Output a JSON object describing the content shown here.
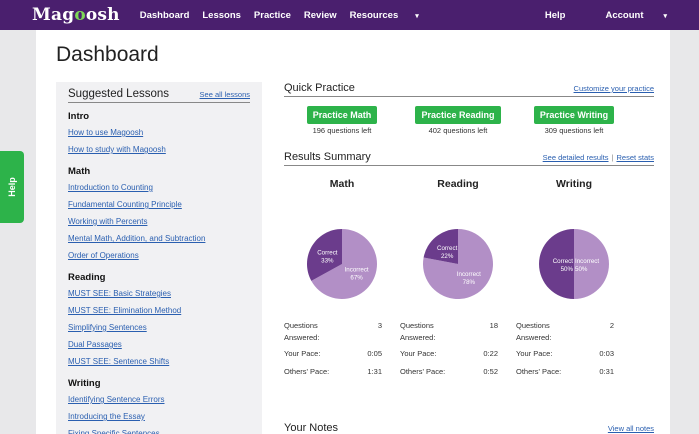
{
  "nav": {
    "logo_main": "Mag",
    "logo_o": "o",
    "logo_tail": "osh",
    "items": [
      "Dashboard",
      "Lessons",
      "Practice",
      "Review",
      "Resources"
    ],
    "resources_caret": "▾",
    "help": "Help",
    "account": "Account",
    "account_caret": "▾"
  },
  "help_tab": "Help",
  "page_title": "Dashboard",
  "suggested": {
    "title": "Suggested Lessons",
    "see_all": "See all lessons",
    "sections": [
      {
        "heading": "Intro",
        "lessons": [
          "How to use Magoosh",
          "How to study with Magoosh"
        ]
      },
      {
        "heading": "Math",
        "lessons": [
          "Introduction to Counting",
          "Fundamental Counting Principle",
          "Working with Percents",
          "Mental Math, Addition, and Subtraction",
          "Order of Operations"
        ]
      },
      {
        "heading": "Reading",
        "lessons": [
          "MUST SEE: Basic Strategies",
          "MUST SEE: Elimination Method",
          "Simplifying Sentences",
          "Dual Passages",
          "MUST SEE: Sentence Shifts"
        ]
      },
      {
        "heading": "Writing",
        "lessons": [
          "Identifying Sentence Errors",
          "Introducing the Essay",
          "Fixing Specific Sentences"
        ]
      }
    ]
  },
  "quick_practice": {
    "title": "Quick Practice",
    "customize": "Customize your practice",
    "buttons": [
      {
        "label": "Practice Math",
        "left": "196 questions left"
      },
      {
        "label": "Practice Reading",
        "left": "402 questions left"
      },
      {
        "label": "Practice Writing",
        "left": "309 questions left"
      }
    ]
  },
  "results": {
    "title": "Results Summary",
    "detail_link": "See detailed results",
    "sep": "|",
    "reset_link": "Reset stats",
    "subjects": [
      {
        "name": "Math",
        "correct_label": "Correct",
        "correct_pct": "33%",
        "correct_fraction": 0.33,
        "incorrect_label": "Incorrect",
        "incorrect_pct": "67%",
        "questions": "3",
        "your_pace": "0:05",
        "others_pace": "1:31"
      },
      {
        "name": "Reading",
        "correct_label": "Correct",
        "correct_pct": "22%",
        "correct_fraction": 0.22,
        "incorrect_label": "Incorrect",
        "incorrect_pct": "78%",
        "questions": "18",
        "your_pace": "0:22",
        "others_pace": "0:52"
      },
      {
        "name": "Writing",
        "correct_label": "Correct",
        "correct_pct": "50%",
        "correct_fraction": 0.5,
        "incorrect_label": "Incorrect",
        "incorrect_pct": "50%",
        "questions": "2",
        "your_pace": "0:03",
        "others_pace": "0:31"
      }
    ],
    "labels": {
      "questions_1": "Questions",
      "questions_2": "Answered:",
      "your_pace": "Your Pace:",
      "others_pace": "Others' Pace:"
    },
    "colors": {
      "correct": "#6b3c8c",
      "incorrect": "#b28fc6"
    }
  },
  "notes": {
    "title": "Your Notes",
    "view_all": "View all notes"
  }
}
